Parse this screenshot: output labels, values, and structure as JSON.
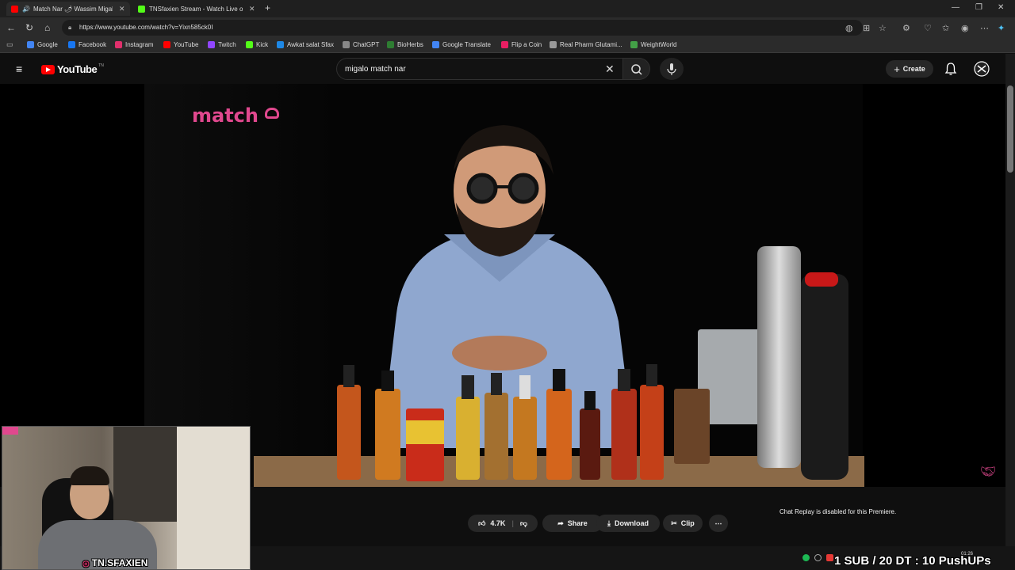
{
  "browser": {
    "tabs": [
      {
        "title": "Match Nar 🌶 Wassim Migal"
      },
      {
        "title": "TNSfaxien Stream - Watch Live o"
      }
    ],
    "new_tab": "+",
    "url": "https://www.youtube.com/watch?v=Yixn585ck0I",
    "window_controls": [
      "—",
      "❐",
      "✕"
    ],
    "bookmarks": [
      {
        "label": "Google",
        "color": "#4285f4"
      },
      {
        "label": "Facebook",
        "color": "#1877f2"
      },
      {
        "label": "Instagram",
        "color": "#e1306c"
      },
      {
        "label": "YouTube",
        "color": "#ff0000"
      },
      {
        "label": "Twitch",
        "color": "#9146ff"
      },
      {
        "label": "Kick",
        "color": "#53fc18"
      },
      {
        "label": "Awkat salat Sfax",
        "color": "#1e88e5"
      },
      {
        "label": "ChatGPT",
        "color": "#888888"
      },
      {
        "label": "BioHerbs",
        "color": "#2e7d32"
      },
      {
        "label": "Google Translate",
        "color": "#4285f4"
      },
      {
        "label": "Flip a Coin",
        "color": "#e91e63"
      },
      {
        "label": "Real Pharm Glutami...",
        "color": "#999999"
      },
      {
        "label": "WeightWorld",
        "color": "#43a047"
      }
    ]
  },
  "youtube": {
    "logo_text": "YouTube",
    "country_code": "TN",
    "search_query": "migalo match nar",
    "create_label": "Create"
  },
  "video": {
    "brand_overlay": "match"
  },
  "actions": {
    "likes": "4.7K",
    "share": "Share",
    "download": "Download",
    "clip": "Clip",
    "chat_replay": "Chat Replay is disabled for this Premiere."
  },
  "stream": {
    "cam_label": "TN.SFAXIEN",
    "ticker": "1 SUB / 20 DT : 10 PushUPs",
    "clock": "01:26"
  }
}
